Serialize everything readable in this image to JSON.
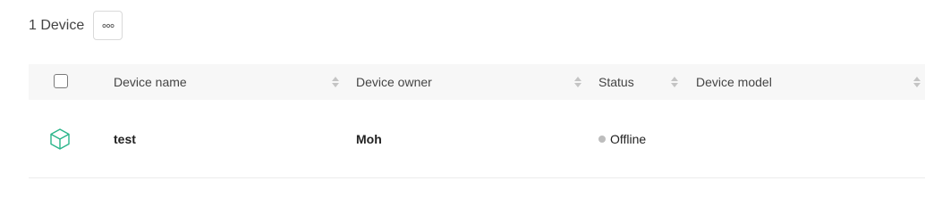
{
  "header": {
    "device_count": "1 Device",
    "more_icon": "more-dots-icon"
  },
  "table": {
    "columns": [
      {
        "label": "Device name"
      },
      {
        "label": "Device owner"
      },
      {
        "label": "Status"
      },
      {
        "label": "Device model"
      }
    ],
    "rows": [
      {
        "icon": "cube-icon",
        "device_name": "test",
        "device_owner": "Moh",
        "status": "Offline",
        "device_model": ""
      }
    ]
  },
  "colors": {
    "device_icon": "#2bb58a",
    "status_offline": "#bdbdbd",
    "header_bg": "#f7f7f7",
    "sort_arrow": "#c4c4c4"
  }
}
